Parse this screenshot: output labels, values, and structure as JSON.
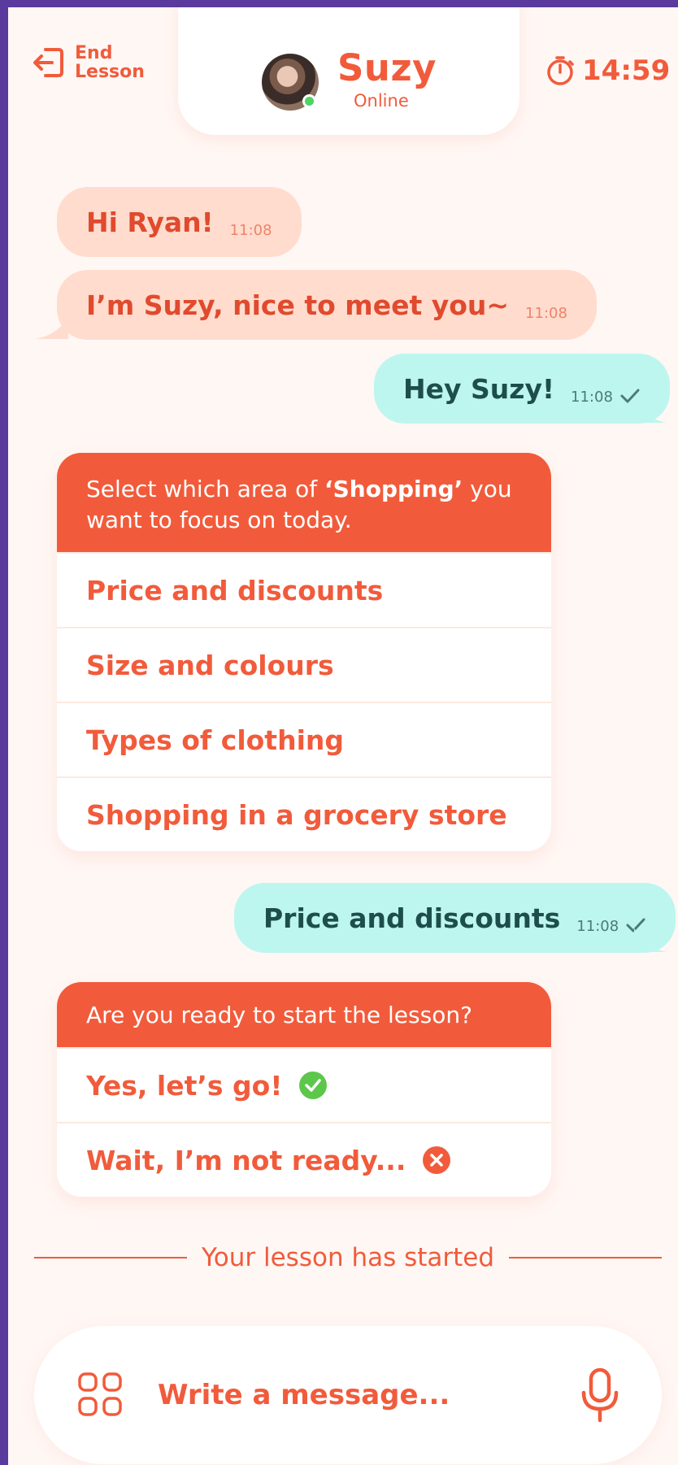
{
  "header": {
    "end_lesson_label": "End\nLesson",
    "tutor_name": "Suzy",
    "tutor_status": "Online",
    "timer": "14:59"
  },
  "messages": [
    {
      "direction": "in",
      "text": "Hi Ryan!",
      "time": "11:08"
    },
    {
      "direction": "in",
      "text": "I’m Suzy, nice to meet you~",
      "time": "11:08"
    },
    {
      "direction": "out",
      "text": "Hey Suzy!",
      "time": "11:08",
      "read": true
    },
    {
      "direction": "out",
      "text": "Price and discounts",
      "time": "11:08",
      "read": true
    }
  ],
  "topic_card": {
    "prompt_before": "Select which area of ",
    "prompt_bold": "‘Shopping’",
    "prompt_after": " you want to focus on today.",
    "options": [
      "Price and discounts",
      "Size and colours",
      "Types of clothing",
      "Shopping in a grocery store"
    ]
  },
  "ready_card": {
    "prompt": "Are you ready to start the lesson?",
    "options": [
      {
        "label": "Yes, let’s go!",
        "icon": "check-circle-icon"
      },
      {
        "label": "Wait, I’m not ready...",
        "icon": "x-circle-icon"
      }
    ]
  },
  "divider_text": "Your lesson has started",
  "composer": {
    "placeholder": "Write a message..."
  },
  "colors": {
    "accent": "#f15b3b",
    "incoming_bubble": "#ffdccd",
    "outgoing_bubble": "#bdf6ee",
    "background": "#fff7f4",
    "frame": "#5b3a9e",
    "online": "#4cd464"
  }
}
